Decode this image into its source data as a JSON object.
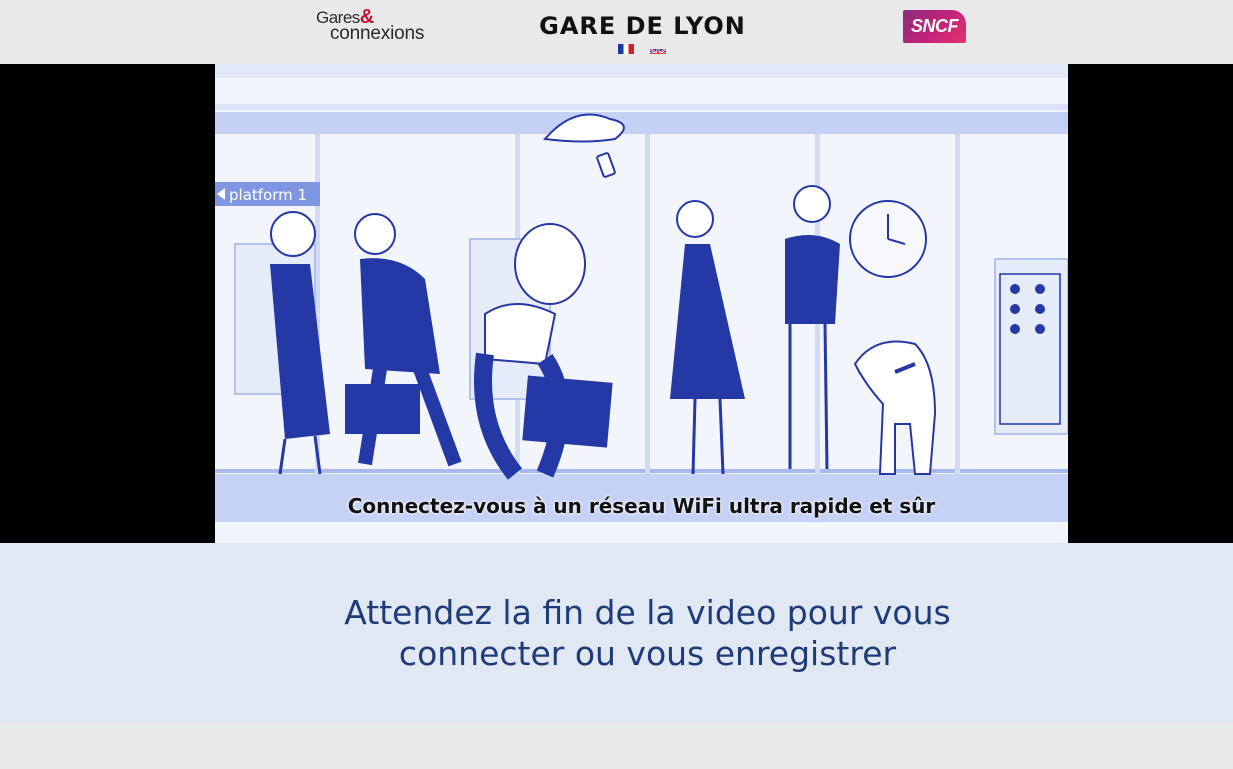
{
  "header": {
    "logo_left": {
      "line1": "Gares",
      "amp": "&",
      "line2": "connexions"
    },
    "station_title": "GARE DE LYON",
    "languages": [
      {
        "code": "fr",
        "icon": "flag-fr-icon"
      },
      {
        "code": "en",
        "icon": "flag-uk-icon"
      }
    ],
    "logo_right": "SNCF"
  },
  "video": {
    "platform_sign": "platform 1",
    "subtitle": "Connectez-vous à un réseau WiFi ultra rapide et sûr"
  },
  "info": {
    "message": "Attendez la fin de la video pour vous connecter ou vous enregistrer"
  },
  "colors": {
    "header_bg": "#e9e9e9",
    "info_bg": "#e0e9f3",
    "info_text": "#1f3a78",
    "sncf_brand": "#c2237a",
    "illustration_blue": "#2438a6"
  }
}
